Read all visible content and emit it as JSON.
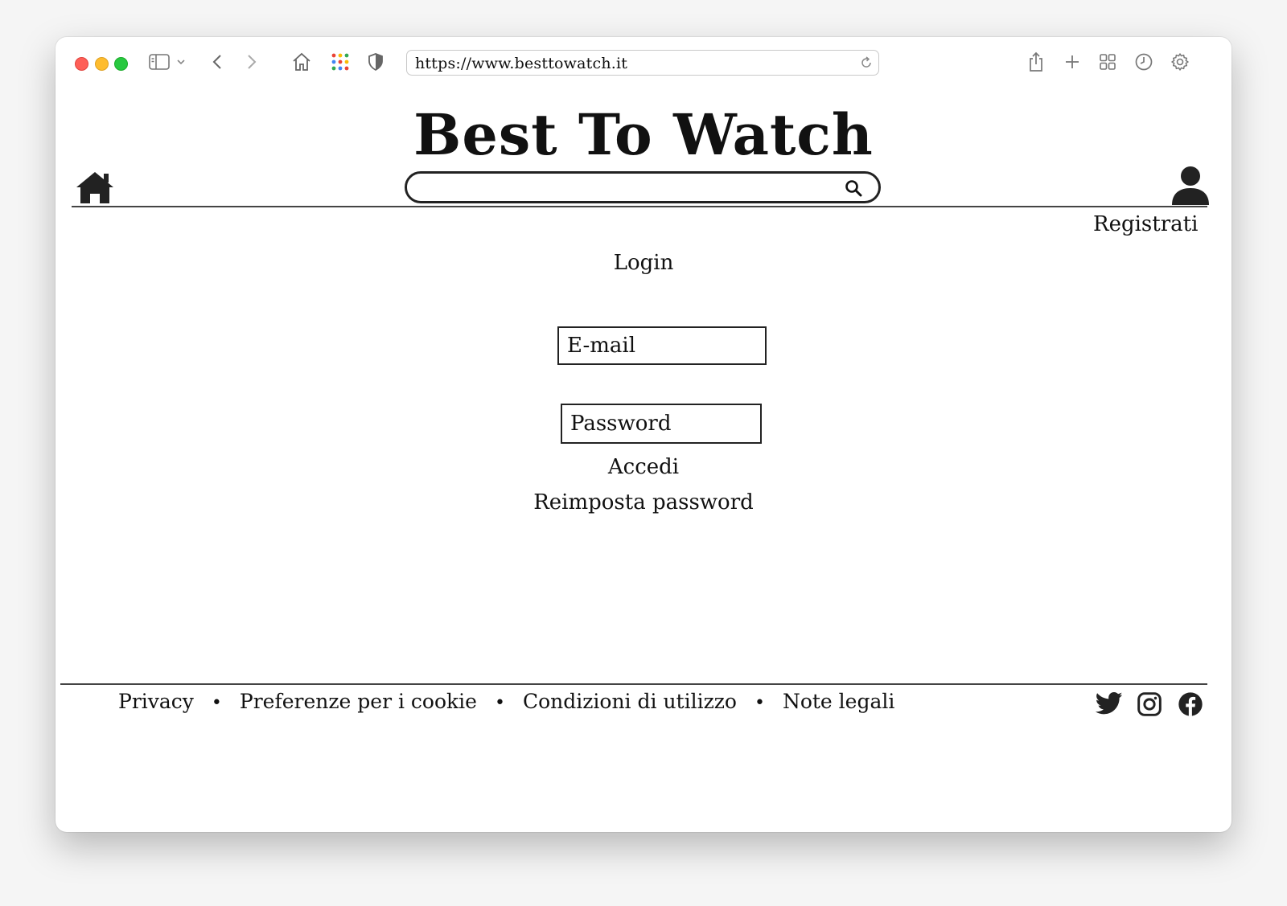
{
  "browser": {
    "url": "https://www.besttowatch.it",
    "icons": [
      "sidebar-icon",
      "chevron-down-icon",
      "back-icon",
      "forward-icon",
      "home-icon",
      "apps-grid-icon",
      "shield-icon",
      "reload-icon",
      "share-icon",
      "plus-icon",
      "tabs-overview-icon",
      "history-icon",
      "gear-icon"
    ]
  },
  "header": {
    "site_title": "Best To Watch",
    "search_placeholder": "",
    "register_label": "Registrati"
  },
  "login": {
    "title": "Login",
    "email_placeholder": "E-mail",
    "password_placeholder": "Password",
    "submit_label": "Accedi",
    "reset_label": "Reimposta password"
  },
  "footer": {
    "links": [
      "Privacy",
      "Preferenze per i cookie",
      "Condizioni di utilizzo",
      "Note legali"
    ],
    "separator": "•",
    "social": [
      "twitter-icon",
      "instagram-icon",
      "facebook-icon"
    ]
  },
  "colors": {
    "ink": "#111111",
    "traffic_red": "#fe5f57",
    "traffic_yellow": "#febc2e",
    "traffic_green": "#28c840"
  }
}
